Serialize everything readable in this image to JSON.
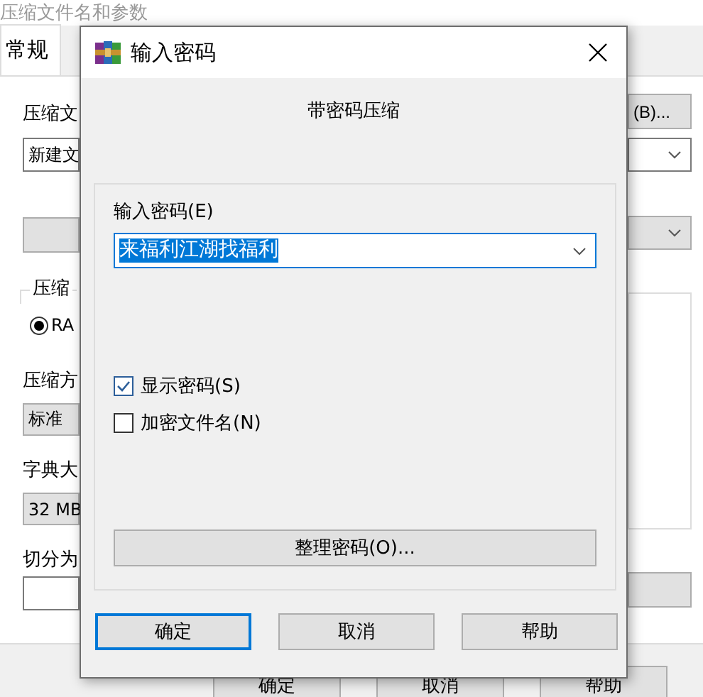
{
  "background_window": {
    "title": "压缩文件名和参数",
    "tabs": [
      {
        "label": "常规",
        "selected": true
      }
    ],
    "left_column": [
      {
        "kind": "label",
        "text": "压缩文"
      },
      {
        "kind": "field",
        "text": "新建文"
      },
      {
        "kind": "button"
      },
      {
        "kind": "group",
        "text": "压缩"
      },
      {
        "kind": "radio",
        "text": "RA",
        "selected": true
      },
      {
        "kind": "label",
        "text": "压缩方"
      },
      {
        "kind": "combo",
        "text": "标准"
      },
      {
        "kind": "label",
        "text": "字典大"
      },
      {
        "kind": "combo",
        "text": "32 MB"
      },
      {
        "kind": "label",
        "text": "切分为"
      },
      {
        "kind": "field"
      }
    ],
    "right_column": [
      {
        "kind": "button",
        "text": "(B)..."
      },
      {
        "kind": "dropdown"
      },
      {
        "kind": "combo"
      },
      {
        "kind": "list"
      },
      {
        "kind": "button"
      }
    ],
    "buttons": [
      "确定",
      "取消",
      "帮助"
    ]
  },
  "dialog": {
    "title": "输入密码",
    "heading": "带密码压缩",
    "password_label": "输入密码(E)",
    "password": "来福利江湖找福利",
    "checkboxes": [
      {
        "label": "显示密码(S)",
        "checked": true
      },
      {
        "label": "加密文件名(N)",
        "checked": false
      }
    ],
    "organize_button": "整理密码(O)...",
    "buttons": [
      {
        "label": "确定",
        "default": true
      },
      {
        "label": "取消",
        "default": false
      },
      {
        "label": "帮助",
        "default": false
      }
    ]
  }
}
